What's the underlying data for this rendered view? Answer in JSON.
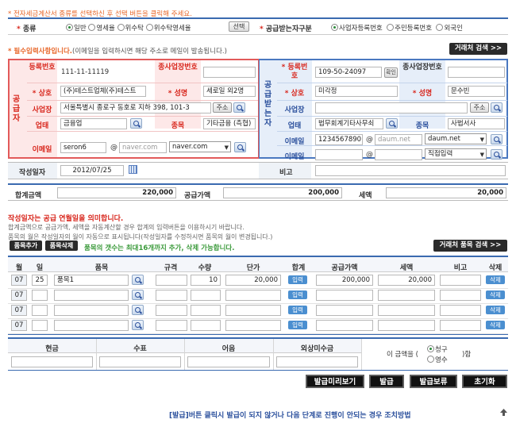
{
  "notice_top": "* 전자세금계산서 종류를 선택하신 후 선택 버튼을 클릭해 주세요.",
  "type_row": {
    "label": "종류",
    "options": [
      "일반",
      "영세율",
      "위수탁",
      "위수탁영세율"
    ],
    "selected": "일반",
    "select_btn": "선택",
    "receiver_label": "공급받는자구분",
    "receiver_options": [
      "사업자등록번호",
      "주민등록번호",
      "외국인"
    ],
    "receiver_selected": "사업자등록번호"
  },
  "required_notice_bold": "* 필수입력사항입니다.",
  "required_notice": "(이메일을 입력하시면 해당 주소로 메일이 발송됩니다.)",
  "partner_search_btn": "거래처 검색 >>",
  "supplier": {
    "side_label": "공급자",
    "reg_no_label": "등록번호",
    "reg_no": "111-11-11119",
    "sub_biz_label": "종사업장번호",
    "company_label": "상호",
    "company": "(주)테스트업체(주)테스트",
    "name_label": "성명",
    "name": "세로일 외2명",
    "address_label": "사업장",
    "address": "서울특별시 종로구 동호로 지하 398, 101-3",
    "address_btn": "주소",
    "biz_type_label": "업태",
    "biz_type": "금융업",
    "biz_item_label": "종목",
    "biz_item": "기타금융 (측협)",
    "email_label": "이메일",
    "email_id": "seron6",
    "email_domain": "naver.com",
    "email_select": "naver.com"
  },
  "receiver": {
    "side_label": "공급받는자",
    "reg_no_label": "등록번호",
    "reg_no": "109-50-24097",
    "confirm_btn": "확인",
    "sub_biz_label": "종사업장번호",
    "company_label": "상호",
    "company": "미각정",
    "name_label": "성명",
    "name": "문수빈",
    "address_label": "사업장",
    "address": "",
    "address_btn": "주소",
    "biz_type_label": "업태",
    "biz_type": "법무회계기타사무쇠",
    "biz_item_label": "종목",
    "biz_item": "사법서사",
    "email_label": "이메일",
    "email_id": "12345678901",
    "email_domain": "daum.net",
    "email_select": "daum.net",
    "email2_label": "이메일",
    "email2_select": "직접입력"
  },
  "write_date_label": "작성일자",
  "write_date": "2012/07/25",
  "remark_label": "비고",
  "totals": {
    "total_label": "합계금액",
    "total": "220,000",
    "supply_label": "공급가액",
    "supply": "200,000",
    "tax_label": "세액",
    "tax": "20,000"
  },
  "notes": {
    "title": "작성일자는 공급 연월일을 의미합니다.",
    "line1": "합계금액으로 공급가액, 세액을 자동계산할 경우 합계의 입력버튼을 이용하시기 바랍니다.",
    "line2": "품목의 월은 작성일자의 월이 자동으로 표시됩니다(작성일자를 수정하시면 품목의 월이 변경됩니다.)"
  },
  "item_add_btn": "품목추가",
  "item_del_btn": "품목삭제",
  "item_notice": "품목의 갯수는 최대16개까지 추가, 삭제 가능합니다.",
  "item_search_btn": "거래처 품목 검색 >>",
  "item_table": {
    "headers": [
      "월",
      "일",
      "품목",
      "규격",
      "수량",
      "단가",
      "합계",
      "공급가액",
      "세액",
      "비고",
      "삭제"
    ],
    "input_btn": "입력",
    "delete_btn": "삭제",
    "rows": [
      {
        "month": "07",
        "day": "25",
        "item": "품목1",
        "spec": "",
        "qty": "10",
        "price": "20,000",
        "supply": "200,000",
        "tax": "20,000",
        "note": ""
      },
      {
        "month": "07",
        "day": "",
        "item": "",
        "spec": "",
        "qty": "",
        "price": "",
        "supply": "",
        "tax": "",
        "note": ""
      },
      {
        "month": "07",
        "day": "",
        "item": "",
        "spec": "",
        "qty": "",
        "price": "",
        "supply": "",
        "tax": "",
        "note": ""
      },
      {
        "month": "07",
        "day": "",
        "item": "",
        "spec": "",
        "qty": "",
        "price": "",
        "supply": "",
        "tax": "",
        "note": ""
      }
    ]
  },
  "payment": {
    "headers": [
      "현금",
      "수표",
      "어음",
      "외상미수금"
    ],
    "amount_text_before": "이 금액을 (",
    "amount_text_after": ")함",
    "option_claim": "청구",
    "option_receipt": "영수",
    "selected": "청구"
  },
  "actions": {
    "preview": "발급미리보기",
    "issue": "발급",
    "hold": "발급보류",
    "reset": "초기화"
  },
  "footer_link": "[발급]버튼 클릭시 발급이 되지 않거나 다음 단계로 진행이 안되는 경우 조치방법"
}
